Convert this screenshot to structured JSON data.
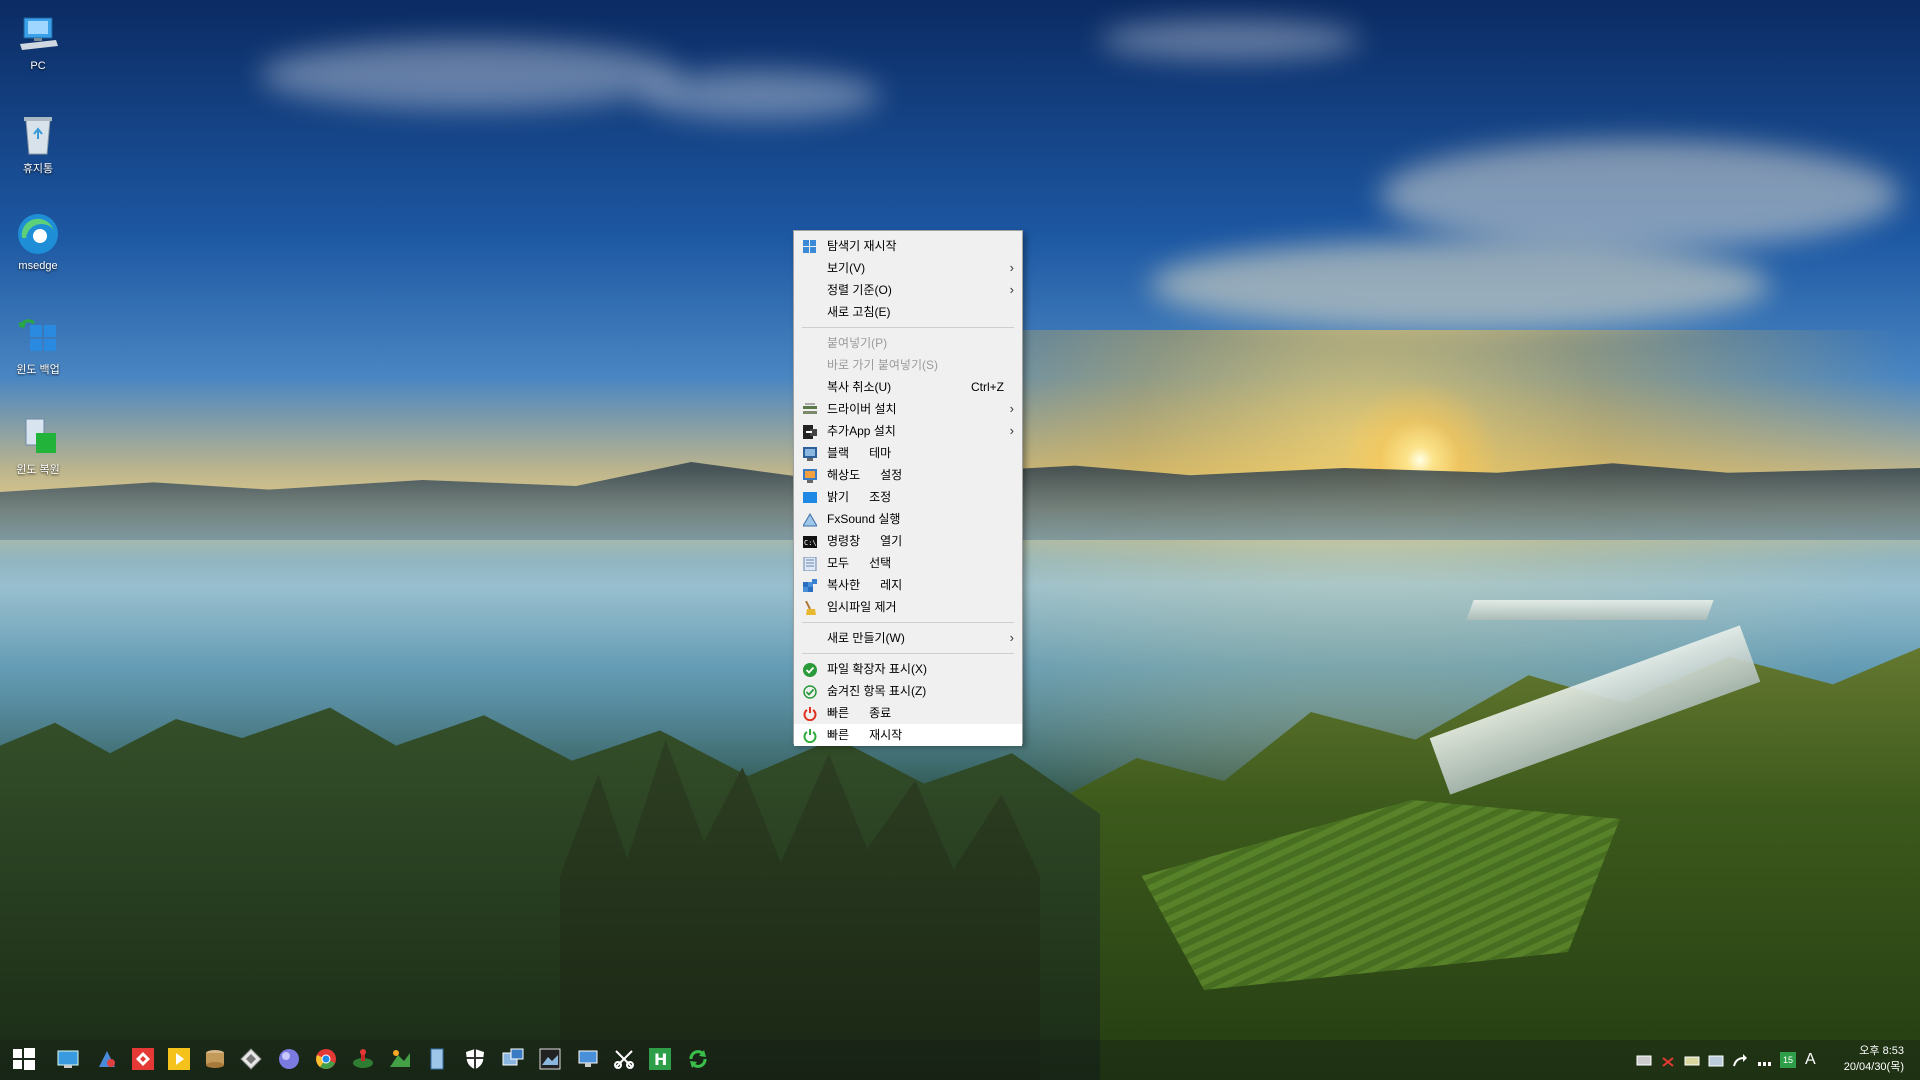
{
  "desktop": {
    "icons": [
      {
        "label": "PC",
        "icon": "pc-icon"
      },
      {
        "label": "휴지통",
        "icon": "recycle-bin-icon"
      },
      {
        "label": "msedge",
        "icon": "edge-icon"
      },
      {
        "label": "윈도 백업",
        "icon": "backup-icon"
      },
      {
        "label": "윈도 복원",
        "icon": "restore-icon"
      }
    ]
  },
  "context_menu": {
    "items": [
      {
        "label": "탐색기 재시작",
        "icon": "explorer-icon"
      },
      {
        "label": "보기(V)",
        "submenu": true
      },
      {
        "label": "정렬 기준(O)",
        "submenu": true
      },
      {
        "label": "새로 고침(E)"
      },
      {
        "label": "붙여넣기(P)",
        "disabled": true
      },
      {
        "label": "바로 가기 붙여넣기(S)",
        "disabled": true
      },
      {
        "label": "복사 취소(U)",
        "shortcut": "Ctrl+Z"
      },
      {
        "label": "드라이버 설치",
        "submenu": true,
        "icon": "driver-icon"
      },
      {
        "label": "추가App 설치",
        "submenu": true,
        "icon": "app-install-icon"
      },
      {
        "label": "블랙      테마",
        "icon": "theme-icon"
      },
      {
        "label": "해상도      설정",
        "icon": "resolution-icon"
      },
      {
        "label": "밝기      조정",
        "icon": "brightness-icon"
      },
      {
        "label": "FxSound 실행",
        "icon": "fxsound-icon"
      },
      {
        "label": "명령창      열기",
        "icon": "cmd-icon"
      },
      {
        "label": "모두      선택",
        "icon": "select-all-icon"
      },
      {
        "label": "복사한      레지",
        "icon": "registry-icon"
      },
      {
        "label": "임시파일 제거",
        "icon": "broom-icon"
      },
      {
        "label": "새로 만들기(W)",
        "submenu": true
      },
      {
        "label": "파일 확장자 표시(X)",
        "icon": "check-circle-icon"
      },
      {
        "label": "숨겨진 항목 표시(Z)",
        "icon": "check-circle-outline-icon"
      },
      {
        "label": "빠른      종료",
        "icon": "power-red-icon"
      },
      {
        "label": "빠른      재시작",
        "icon": "power-green-icon",
        "hover": true
      }
    ]
  },
  "taskbar": {
    "start_icon": "windows-start-icon",
    "pinned": [
      "desktop-icon",
      "paint-icon",
      "anydesk-icon",
      "potplayer-icon",
      "disk-icon",
      "diamond-icon",
      "orb-icon",
      "chrome-icon",
      "joystick-icon",
      "landscape-icon",
      "document-icon",
      "shield-icon",
      "remote-icon",
      "image-icon",
      "monitor-icon",
      "scissors-icon",
      "h-editor-icon",
      "refresh-icon"
    ],
    "clock": {
      "time": "오후 8:53",
      "date": "20/04/30(목)"
    },
    "ime": "A",
    "tray_badge": "15"
  },
  "colors": {
    "menu_bg": "#f0f0f0",
    "menu_border": "#a0a0a0",
    "disabled_text": "#9b9b9b",
    "power_red": "#e0301e",
    "power_green": "#2eab3a"
  }
}
